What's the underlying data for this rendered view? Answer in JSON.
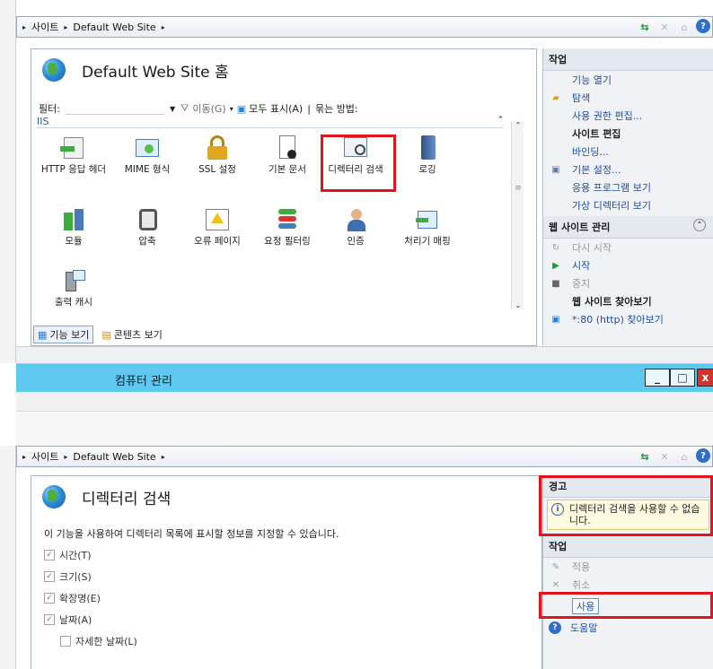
{
  "top_window": {
    "breadcrumb": [
      "사이트",
      "Default Web Site"
    ],
    "home_title": "Default Web Site 홈",
    "filter": {
      "label": "필터:",
      "go_label": "이동(G)",
      "show_all_label": "모두 표시(A)",
      "group_by_label": "묶는 방법:"
    },
    "section_label": "IIS",
    "features": [
      {
        "label": "HTTP 응답 헤더",
        "icon": "http-response-headers-icon"
      },
      {
        "label": "MIME 형식",
        "icon": "mime-types-icon"
      },
      {
        "label": "SSL 설정",
        "icon": "ssl-lock-icon"
      },
      {
        "label": "기본 문서",
        "icon": "default-document-icon"
      },
      {
        "label": "디렉터리 검색",
        "icon": "directory-browsing-icon"
      },
      {
        "label": "로깅",
        "icon": "logging-book-icon"
      },
      {
        "label": "모듈",
        "icon": "modules-icon"
      },
      {
        "label": "압축",
        "icon": "compression-icon"
      },
      {
        "label": "오류 페이지",
        "icon": "error-pages-icon"
      },
      {
        "label": "요청 필터링",
        "icon": "request-filtering-icon"
      },
      {
        "label": "인증",
        "icon": "authentication-icon"
      },
      {
        "label": "처리기 매핑",
        "icon": "handler-mappings-icon"
      },
      {
        "label": "출력 캐시",
        "icon": "output-cache-icon"
      }
    ],
    "view_tabs": [
      "기능 보기",
      "콘텐츠 보기"
    ],
    "actions": {
      "header": "작업",
      "open_feature": "기능 열기",
      "explore": "탐색",
      "edit_permissions": "사용 권한 편집...",
      "edit_site_header": "사이트 편집",
      "bindings": "바인딩...",
      "basic_settings": "기본 설정...",
      "view_applications": "응용 프로그램 보기",
      "view_virtual_dirs": "가상 디렉터리 보기",
      "manage_site_header": "웹 사이트 관리",
      "restart": "다시 시작",
      "start": "시작",
      "stop": "중지",
      "browse_header": "웹 사이트 찾아보기",
      "browse_80": "*:80 (http) 찾아보기"
    }
  },
  "computer_management": {
    "title": "컴퓨터 관리",
    "min_label": "_",
    "max_label": "□",
    "close_label": "x"
  },
  "bottom_window": {
    "breadcrumb": [
      "사이트",
      "Default Web Site"
    ],
    "page_title": "디렉터리 검색",
    "description": "이 기능을 사용하여 디렉터리 목록에 표시할 정보를 지정할 수 있습니다.",
    "options": [
      {
        "label": "시간(T)",
        "checked": true,
        "checked_mark": "✓"
      },
      {
        "label": "크기(S)",
        "checked": true,
        "checked_mark": "✓"
      },
      {
        "label": "확장명(E)",
        "checked": true,
        "checked_mark": "✓"
      },
      {
        "label": "날짜(A)",
        "checked": true,
        "checked_mark": "✓"
      }
    ],
    "sub_option": "자세한 날짜(L)",
    "alerts_header": "경고",
    "alert_text": "디렉터리 검색을 사용할 수 없습니다.",
    "actions_header": "작업",
    "apply": "적용",
    "cancel": "취소",
    "enable": "사용",
    "help": "도움말"
  },
  "colors": {
    "highlight_red": "#e0141b",
    "title_bar_blue": "#5fc8ee",
    "link_blue": "#1f4fa8"
  }
}
